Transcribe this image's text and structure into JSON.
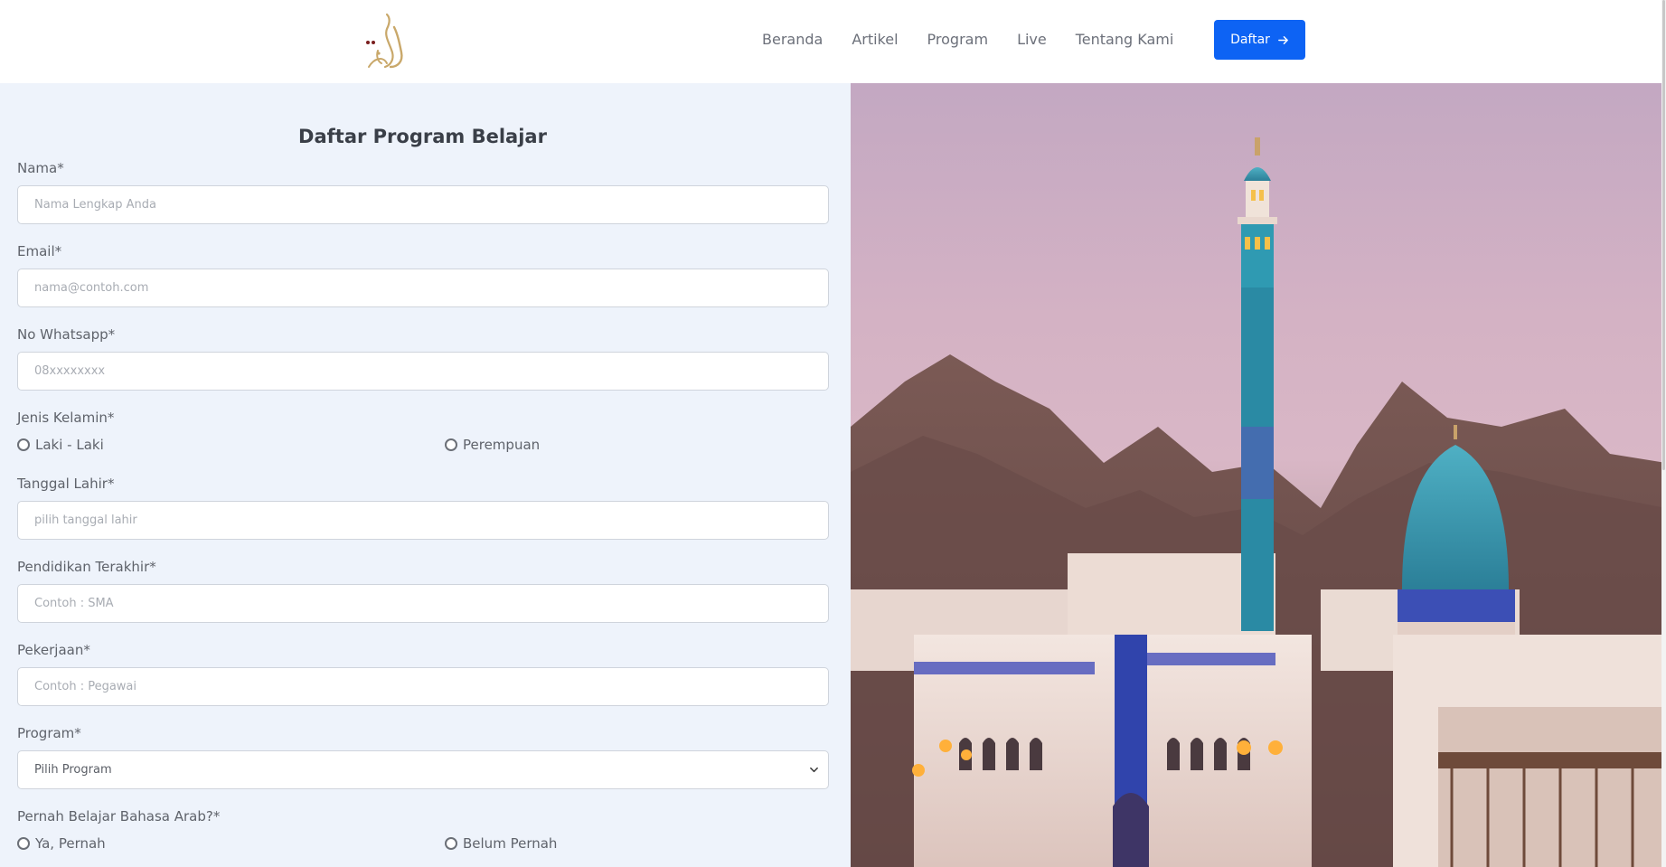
{
  "navbar": {
    "links": [
      "Beranda",
      "Artikel",
      "Program",
      "Live",
      "Tentang Kami"
    ],
    "cta_label": "Daftar"
  },
  "form": {
    "title": "Daftar Program Belajar",
    "nama": {
      "label": "Nama*",
      "placeholder": "Nama Lengkap Anda"
    },
    "email": {
      "label": "Email*",
      "placeholder": "nama@contoh.com"
    },
    "whatsapp": {
      "label": "No Whatsapp*",
      "placeholder": "08xxxxxxxx"
    },
    "gender": {
      "label": "Jenis Kelamin*",
      "options": [
        "Laki - Laki",
        "Perempuan"
      ]
    },
    "birthdate": {
      "label": "Tanggal Lahir*",
      "placeholder": "pilih tanggal lahir"
    },
    "education": {
      "label": "Pendidikan Terakhir*",
      "placeholder": "Contoh : SMA"
    },
    "job": {
      "label": "Pekerjaan*",
      "placeholder": "Contoh : Pegawai"
    },
    "program": {
      "label": "Program*",
      "selected": "Pilih Program"
    },
    "arabic_experience": {
      "label": "Pernah Belajar Bahasa Arab?*",
      "options": [
        "Ya, Pernah",
        "Belum Pernah"
      ]
    }
  },
  "colors": {
    "accent": "#0d63f4",
    "form_background": "#eef3fb",
    "logo_gold": "#c9a86a"
  },
  "icons": {
    "cta": "arrow-right-icon",
    "select": "chevron-down-icon"
  }
}
